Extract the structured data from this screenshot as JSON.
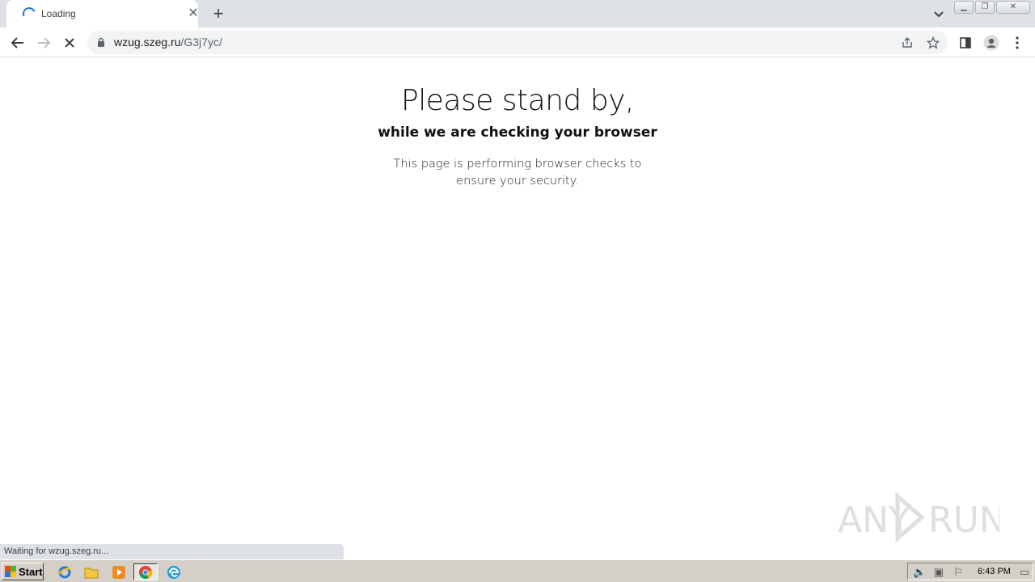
{
  "browser": {
    "tab": {
      "title": "Loading",
      "close_glyph": "✕"
    },
    "new_tab_glyph": "+",
    "address": {
      "host": "wzug.szeg.ru",
      "path": "/G3j7yc/"
    },
    "status_text": "Waiting for wzug.szeg.ru..."
  },
  "page": {
    "heading": "Please stand by,",
    "subheading": "while we are checking your browser",
    "paragraph": "This page is performing browser checks to ensure your security."
  },
  "taskbar": {
    "start_label": "Start",
    "clock": "6:43 PM"
  },
  "watermark": {
    "text_left": "ANY",
    "text_right": "RUN"
  },
  "colors": {
    "accent": "#1a73e8",
    "tabstrip": "#dee1e6",
    "omnibox": "#f1f3f4",
    "taskbar": "#d4d0c8"
  }
}
